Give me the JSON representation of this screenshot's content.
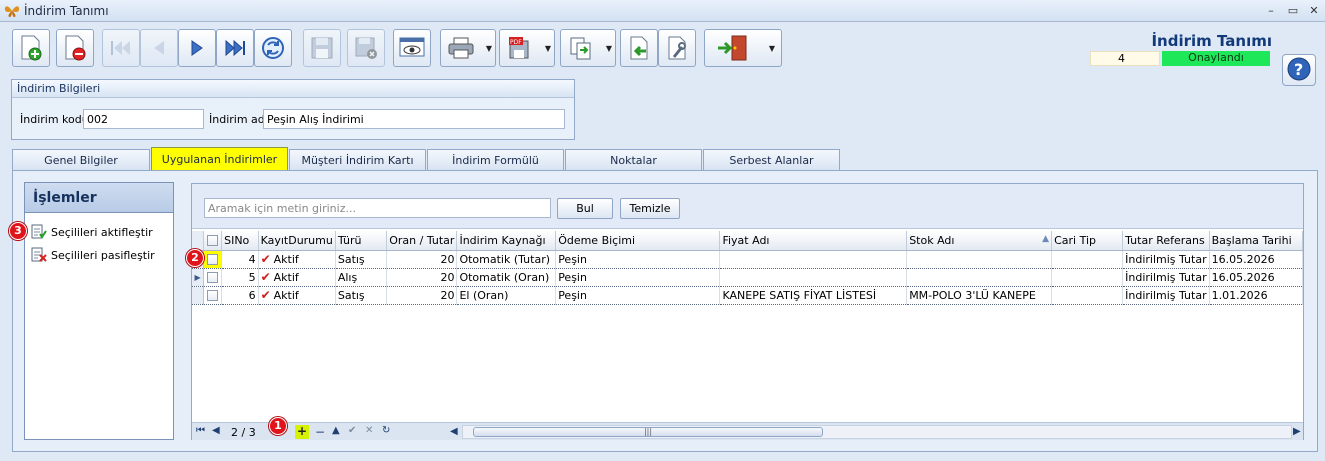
{
  "window": {
    "title": "İndirim Tanımı"
  },
  "header": {
    "title": "İndirim Tanımı",
    "record_count": "4",
    "status": "Onaylandı",
    "status_color": "#1ee85a"
  },
  "toolbar": {
    "buttons": [
      {
        "name": "new",
        "icon": "new-document-icon"
      },
      {
        "name": "delete",
        "icon": "delete-document-icon"
      },
      {
        "name": "first",
        "icon": "first-record-icon"
      },
      {
        "name": "previous",
        "icon": "previous-record-icon"
      },
      {
        "name": "next",
        "icon": "next-record-icon"
      },
      {
        "name": "last",
        "icon": "last-record-icon"
      },
      {
        "name": "refresh",
        "icon": "refresh-icon"
      },
      {
        "name": "save",
        "icon": "save-icon"
      },
      {
        "name": "save-close",
        "icon": "save-close-icon"
      },
      {
        "name": "preview",
        "icon": "preview-icon"
      },
      {
        "name": "print",
        "icon": "printer-icon"
      },
      {
        "name": "pdf",
        "icon": "pdf-icon"
      },
      {
        "name": "copy",
        "icon": "copy-icon"
      },
      {
        "name": "import",
        "icon": "import-icon"
      },
      {
        "name": "tools",
        "icon": "tools-icon"
      },
      {
        "name": "exit",
        "icon": "exit-door-icon"
      }
    ]
  },
  "info": {
    "group_title": "İndirim Bilgileri",
    "code_label": "İndirim kodu",
    "code_value": "002",
    "name_label": "İndirim adı",
    "name_value": "Peşin Alış İndirimi"
  },
  "tabs": [
    {
      "label": "Genel Bilgiler",
      "active": false
    },
    {
      "label": "Uygulanan İndirimler",
      "active": true
    },
    {
      "label": "Müşteri İndirim Kartı",
      "active": false
    },
    {
      "label": "İndirim Formülü",
      "active": false
    },
    {
      "label": "Noktalar",
      "active": false
    },
    {
      "label": "Serbest Alanlar",
      "active": false
    }
  ],
  "operations": {
    "title": "İşlemler",
    "items": [
      {
        "label": "Seçilileri aktifleştir",
        "icon": "activate-icon"
      },
      {
        "label": "Seçilileri pasifleştir",
        "icon": "deactivate-icon"
      }
    ]
  },
  "search": {
    "placeholder": "Aramak için metin giriniz...",
    "find_label": "Bul",
    "clear_label": "Temizle"
  },
  "grid": {
    "columns": [
      "SINo",
      "KayıtDurumu",
      "Türü",
      "Oran / Tutar",
      "İndirim Kaynağı",
      "Ödeme Biçimi",
      "Fiyat Adı",
      "Stok Adı",
      "Cari Tip",
      "Tutar Referans",
      "Başlama Tarihi"
    ],
    "rows": [
      {
        "sino": "4",
        "durum": "Aktif",
        "turu": "Satış",
        "oran": "20",
        "kaynak": "Otomatik (Tutar)",
        "odeme": "Peşin",
        "fiyat": "",
        "stok": "",
        "cari": "",
        "referans": "İndirilmiş Tutar",
        "baslama": "16.05.2026"
      },
      {
        "sino": "5",
        "durum": "Aktif",
        "turu": "Alış",
        "oran": "20",
        "kaynak": "Otomatik (Oran)",
        "odeme": "Peşin",
        "fiyat": "",
        "stok": "",
        "cari": "",
        "referans": "İndirilmiş Tutar",
        "baslama": "16.05.2026"
      },
      {
        "sino": "6",
        "durum": "Aktif",
        "turu": "Satış",
        "oran": "20",
        "kaynak": "El (Oran)",
        "odeme": "Peşin",
        "fiyat": "KANEPE SATIŞ FİYAT LİSTESİ",
        "stok": "MM-POLO 3'LÜ KANEPE",
        "cari": "",
        "referans": "İndirilmiş Tutar",
        "baslama": "1.01.2026"
      }
    ]
  },
  "navigator": {
    "position": "2 / 3"
  },
  "badges": {
    "one": "1",
    "two": "2",
    "three": "3"
  }
}
